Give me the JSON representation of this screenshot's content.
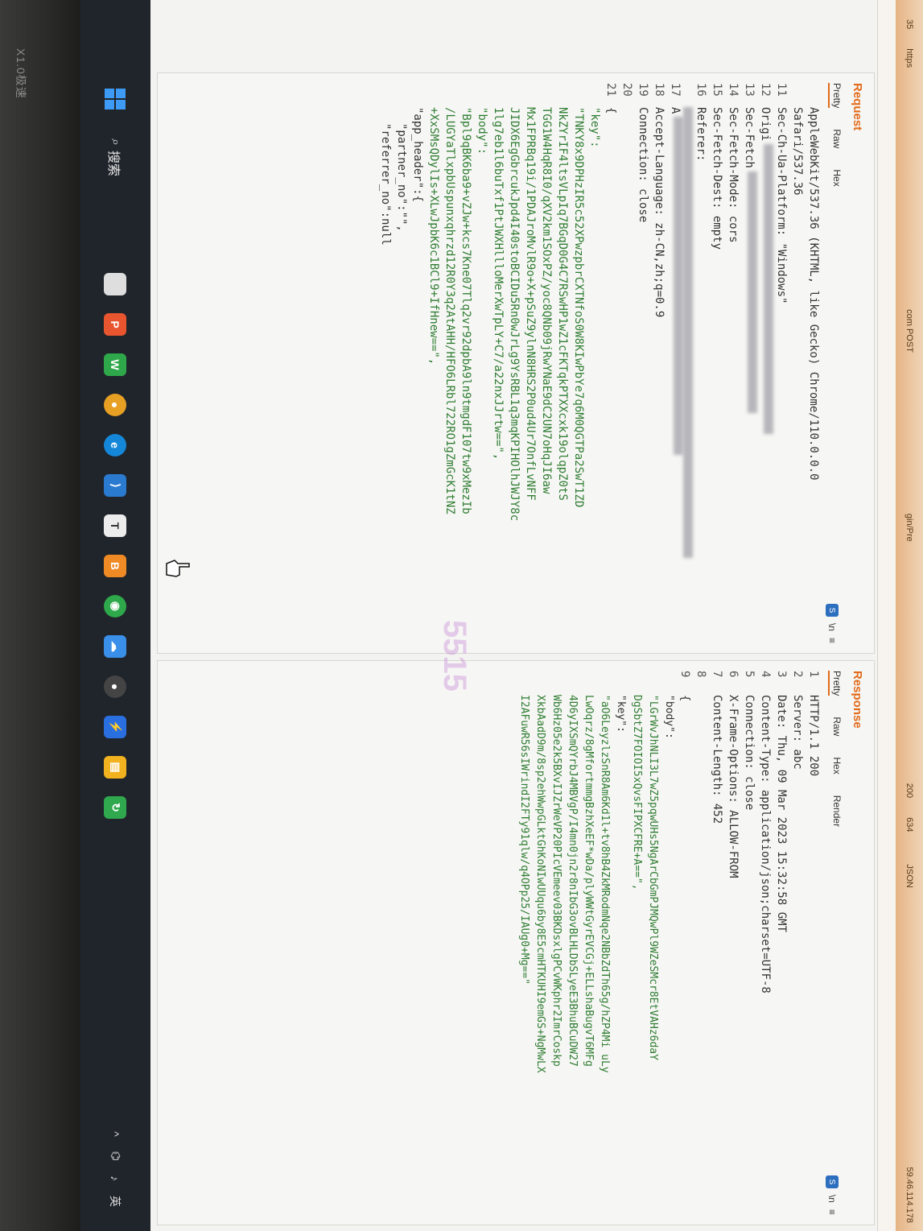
{
  "bezel_label": "X1.0极速",
  "strip": {
    "items": [
      "35",
      "https",
      "com POST",
      "gin/Pre",
      "200",
      "634",
      "JSON",
      "59.46.114.178"
    ]
  },
  "request": {
    "title": "Request",
    "tabs": [
      "Pretty",
      "Raw",
      "Hex"
    ],
    "lines": [
      {
        "n": "",
        "t": "AppleWebKit/537.36 (KHTML, like Gecko) Chrome/110.0.0.0"
      },
      {
        "n": "",
        "t": "Safari/537.36"
      },
      {
        "n": "11",
        "t": "Sec-Ch-Ua-Platform: \"Windows\""
      },
      {
        "n": "12",
        "t": "Origi"
      },
      {
        "n": "13",
        "t": "Sec-Fetch"
      },
      {
        "n": "14",
        "t": "Sec-Fetch-Mode: cors"
      },
      {
        "n": "15",
        "t": "Sec-Fetch-Dest: empty"
      },
      {
        "n": "16",
        "t": "Referer:"
      },
      {
        "n": "",
        "t": ""
      },
      {
        "n": "17",
        "t": "A"
      },
      {
        "n": "18",
        "t": "Accept-Language: zh-CN,zh;q=0.9"
      },
      {
        "n": "19",
        "t": "Connection: close"
      },
      {
        "n": "20",
        "t": ""
      },
      {
        "n": "21",
        "t": "{"
      }
    ],
    "json_lines": [
      "\"key\":",
      "\"TNKY8x9DPHzIR5c52XPwzpbrCXTNfoS0W8KIwPbYe7q6M0QGTPa2SwT1ZD",
      "NkZYrIF4ltsVLpIq7BGqD0G4C7RSwHP1wZ1cFKTqkPTXXcxk19olqpZ0tS",
      "TGG1W4HqR8I0/qXV2km1SOxPZ/yoc8QNb09jRwYNaE9dC2UN7oHqJI6aw",
      "Mx1FPRBq19i/1PDAJroMvlR9o+X+pSuZ9ylnN8HRS2P0ud4Ur7OnfLvNFF",
      "JIDX6EgGbrcukJpd4I40stoBCIDu5Rn0wJrLg9YsRBL1q3mqKPIHOlhJWJY8c",
      "1lg7eb1l6buTxf1PtJWXHllloMerXwTpLY+C7/a22nxJJrtw==\",",
      "\"body\":",
      "\"Bpl9qBK6ba9+vZJw+kcs7Kne07Tlq2vr92dpbA9ln9tmgdF107tw9xMezIb",
      "/LUGYaTlxpbUspunxqhrzd12R0Y3q2AtAHH/HFO6LRbl722RO1gZmGcK1tNZ",
      "+XxSMsQDylIs+XLwJpbK6c1BCl9+IfHnew==\",",
      "\"app_header\":{",
      "\"partner_no\":\"\",",
      "\"referrer_no\":null"
    ]
  },
  "response": {
    "title": "Response",
    "tabs": [
      "Pretty",
      "Raw",
      "Hex",
      "Render"
    ],
    "lines": [
      {
        "n": "1",
        "t": "HTTP/1.1 200"
      },
      {
        "n": "2",
        "t": "Server: abc"
      },
      {
        "n": "3",
        "t": "Date: Thu, 09 Mar 2023 15:32:58 GMT"
      },
      {
        "n": "4",
        "t": "Content-Type: application/json;charset=UTF-8"
      },
      {
        "n": "5",
        "t": "Connection: close"
      },
      {
        "n": "6",
        "t": "X-Frame-Options: ALLOW-FROM"
      },
      {
        "n": "7",
        "t": "Content-Length: 452"
      },
      {
        "n": "8",
        "t": ""
      },
      {
        "n": "9",
        "t": "{"
      }
    ],
    "json_lines": [
      "\"body\":",
      "\"LGrWvJhNLI3L7wZ5pqwUHs5NgArCbGmPJMQwPl9WZeSMcr8EtVAHz6daY",
      "DgSbtZ7FOIOI5xQvsFIPXCFRE+A==\",",
      "\"key\":",
      "\"aO6LeyzlzSnR8Am6Kd1l+tv8hB4ZkMRodmNqe2NBbZdTh65g/hZP4Mi uLy",
      "LwOqrz/8gMfortmmgBzhXeEF*wDa/plyWWtGyrEVCGj+ELLshaBugvT6MFg",
      "4D6yIXSmQYrbJ4MBVgP/I4mn0jn2r8nIbG3ovBLHLDbSLyeE3BhuBCuDW27",
      "Wb6Hz05e2k5BXvIJZrWeVP20PIcVEmeev03BKDsxlgPCvWKphr2ImrCoskp",
      "XkbAadD9m/8sp2ehWwpGLktGhKoNIwUUqu6by8E5cmHTKUHI9emGS+NgMwLX",
      "I2AFuwR56sIWrindI2FTy91qlw/q4OPp25/IAUg0+Mg==\""
    ]
  },
  "watermark": "5515",
  "taskbar": {
    "search_label": "搜索",
    "tray": [
      "^",
      "英"
    ]
  }
}
